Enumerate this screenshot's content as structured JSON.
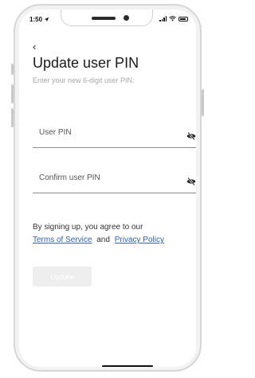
{
  "status": {
    "time": "1:50"
  },
  "nav": {
    "back": "‹"
  },
  "header": {
    "title": "Update user PIN",
    "subtitle": "Enter your new 6-digit user PIN."
  },
  "form": {
    "pin_placeholder": "User PIN",
    "confirm_placeholder": "Confirm user PIN"
  },
  "terms": {
    "prefix": "By signing up, you agree to our",
    "tos": "Terms of Service",
    "and": "and",
    "privacy": "Privacy Policy"
  },
  "actions": {
    "update": "Update"
  },
  "icons": {
    "location": "location-arrow-icon",
    "signal": "signal-icon",
    "wifi": "wifi-icon",
    "battery": "battery-icon",
    "visibility": "eye-slash-icon"
  },
  "colors": {
    "link": "#2e5fb7",
    "disabled_button": "#eeeeee"
  }
}
